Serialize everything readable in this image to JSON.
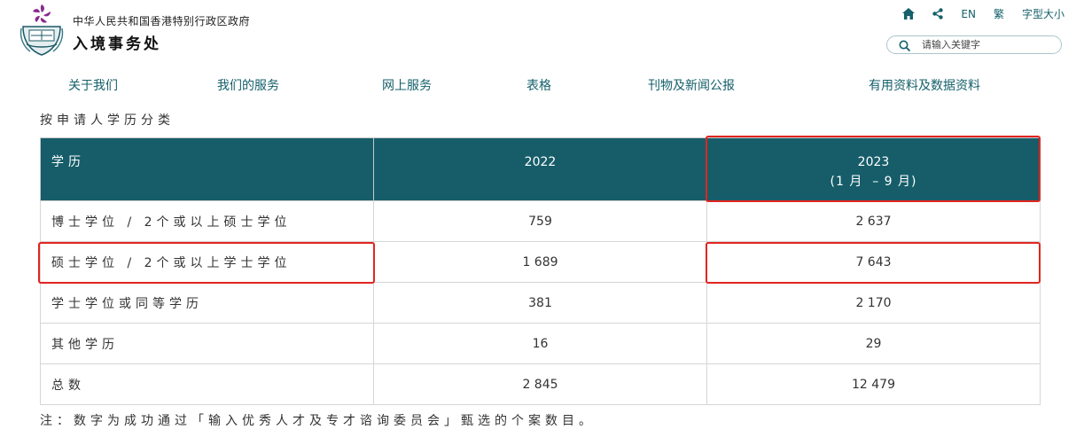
{
  "header": {
    "gov_name": "中华人民共和国香港特别行政区政府",
    "dept_name": "入境事务处",
    "logo_icon": "hk-immigration-emblem-icon"
  },
  "toplinks": {
    "home_icon": "home-icon",
    "share_icon": "share-icon",
    "en": "EN",
    "trad": "繁",
    "font_size": "字型大小"
  },
  "search": {
    "placeholder": "请输入关键字",
    "icon": "search-icon"
  },
  "nav": [
    {
      "label": "关于我们"
    },
    {
      "label": "我们的服务"
    },
    {
      "label": "网上服务"
    },
    {
      "label": "表格"
    },
    {
      "label": "刊物及新闻公报"
    },
    {
      "label": "有用资料及数据资料"
    }
  ],
  "caption": "按申请人学历分类",
  "table": {
    "headers": {
      "col1": "学历",
      "col2": "2022",
      "col3_line1": "2023",
      "col3_line2": "(1 月  – 9 月)"
    },
    "rows": [
      {
        "label": "博士学位 / 2个或以上硕士学位",
        "y2022": "759",
        "y2023": "2 637"
      },
      {
        "label": "硕士学位 / 2个或以上学士学位",
        "y2022": "1 689",
        "y2023": "7 643"
      },
      {
        "label": "学士学位或同等学历",
        "y2022": "381",
        "y2023": "2 170"
      },
      {
        "label": "其他学历",
        "y2022": "16",
        "y2023": "29"
      },
      {
        "label": "总数",
        "y2022": "2 845",
        "y2023": "12 479"
      }
    ]
  },
  "note": "注：数字为成功通过「输入优秀人才及专才谘询委员会」甄选的个案数目。",
  "colors": {
    "header_bg": "#165d69",
    "link": "#15606b",
    "highlight": "#e0251f"
  }
}
